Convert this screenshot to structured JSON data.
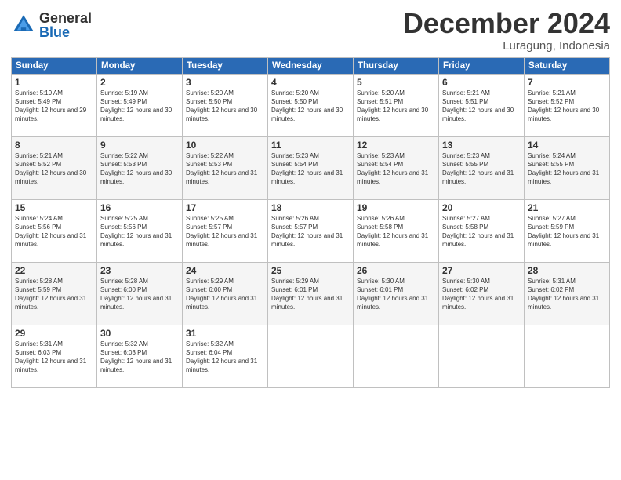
{
  "logo": {
    "general": "General",
    "blue": "Blue"
  },
  "header": {
    "month": "December 2024",
    "location": "Luragung, Indonesia"
  },
  "weekdays": [
    "Sunday",
    "Monday",
    "Tuesday",
    "Wednesday",
    "Thursday",
    "Friday",
    "Saturday"
  ],
  "weeks": [
    [
      {
        "day": 1,
        "sunrise": "5:19 AM",
        "sunset": "5:49 PM",
        "daylight": "12 hours and 29 minutes."
      },
      {
        "day": 2,
        "sunrise": "5:19 AM",
        "sunset": "5:49 PM",
        "daylight": "12 hours and 30 minutes."
      },
      {
        "day": 3,
        "sunrise": "5:20 AM",
        "sunset": "5:50 PM",
        "daylight": "12 hours and 30 minutes."
      },
      {
        "day": 4,
        "sunrise": "5:20 AM",
        "sunset": "5:50 PM",
        "daylight": "12 hours and 30 minutes."
      },
      {
        "day": 5,
        "sunrise": "5:20 AM",
        "sunset": "5:51 PM",
        "daylight": "12 hours and 30 minutes."
      },
      {
        "day": 6,
        "sunrise": "5:21 AM",
        "sunset": "5:51 PM",
        "daylight": "12 hours and 30 minutes."
      },
      {
        "day": 7,
        "sunrise": "5:21 AM",
        "sunset": "5:52 PM",
        "daylight": "12 hours and 30 minutes."
      }
    ],
    [
      {
        "day": 8,
        "sunrise": "5:21 AM",
        "sunset": "5:52 PM",
        "daylight": "12 hours and 30 minutes."
      },
      {
        "day": 9,
        "sunrise": "5:22 AM",
        "sunset": "5:53 PM",
        "daylight": "12 hours and 30 minutes."
      },
      {
        "day": 10,
        "sunrise": "5:22 AM",
        "sunset": "5:53 PM",
        "daylight": "12 hours and 31 minutes."
      },
      {
        "day": 11,
        "sunrise": "5:23 AM",
        "sunset": "5:54 PM",
        "daylight": "12 hours and 31 minutes."
      },
      {
        "day": 12,
        "sunrise": "5:23 AM",
        "sunset": "5:54 PM",
        "daylight": "12 hours and 31 minutes."
      },
      {
        "day": 13,
        "sunrise": "5:23 AM",
        "sunset": "5:55 PM",
        "daylight": "12 hours and 31 minutes."
      },
      {
        "day": 14,
        "sunrise": "5:24 AM",
        "sunset": "5:55 PM",
        "daylight": "12 hours and 31 minutes."
      }
    ],
    [
      {
        "day": 15,
        "sunrise": "5:24 AM",
        "sunset": "5:56 PM",
        "daylight": "12 hours and 31 minutes."
      },
      {
        "day": 16,
        "sunrise": "5:25 AM",
        "sunset": "5:56 PM",
        "daylight": "12 hours and 31 minutes."
      },
      {
        "day": 17,
        "sunrise": "5:25 AM",
        "sunset": "5:57 PM",
        "daylight": "12 hours and 31 minutes."
      },
      {
        "day": 18,
        "sunrise": "5:26 AM",
        "sunset": "5:57 PM",
        "daylight": "12 hours and 31 minutes."
      },
      {
        "day": 19,
        "sunrise": "5:26 AM",
        "sunset": "5:58 PM",
        "daylight": "12 hours and 31 minutes."
      },
      {
        "day": 20,
        "sunrise": "5:27 AM",
        "sunset": "5:58 PM",
        "daylight": "12 hours and 31 minutes."
      },
      {
        "day": 21,
        "sunrise": "5:27 AM",
        "sunset": "5:59 PM",
        "daylight": "12 hours and 31 minutes."
      }
    ],
    [
      {
        "day": 22,
        "sunrise": "5:28 AM",
        "sunset": "5:59 PM",
        "daylight": "12 hours and 31 minutes."
      },
      {
        "day": 23,
        "sunrise": "5:28 AM",
        "sunset": "6:00 PM",
        "daylight": "12 hours and 31 minutes."
      },
      {
        "day": 24,
        "sunrise": "5:29 AM",
        "sunset": "6:00 PM",
        "daylight": "12 hours and 31 minutes."
      },
      {
        "day": 25,
        "sunrise": "5:29 AM",
        "sunset": "6:01 PM",
        "daylight": "12 hours and 31 minutes."
      },
      {
        "day": 26,
        "sunrise": "5:30 AM",
        "sunset": "6:01 PM",
        "daylight": "12 hours and 31 minutes."
      },
      {
        "day": 27,
        "sunrise": "5:30 AM",
        "sunset": "6:02 PM",
        "daylight": "12 hours and 31 minutes."
      },
      {
        "day": 28,
        "sunrise": "5:31 AM",
        "sunset": "6:02 PM",
        "daylight": "12 hours and 31 minutes."
      }
    ],
    [
      {
        "day": 29,
        "sunrise": "5:31 AM",
        "sunset": "6:03 PM",
        "daylight": "12 hours and 31 minutes."
      },
      {
        "day": 30,
        "sunrise": "5:32 AM",
        "sunset": "6:03 PM",
        "daylight": "12 hours and 31 minutes."
      },
      {
        "day": 31,
        "sunrise": "5:32 AM",
        "sunset": "6:04 PM",
        "daylight": "12 hours and 31 minutes."
      },
      null,
      null,
      null,
      null
    ]
  ]
}
